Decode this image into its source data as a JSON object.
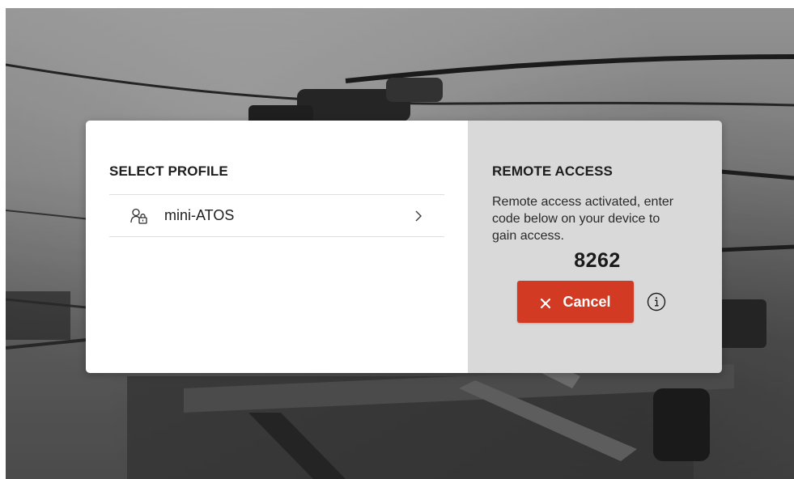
{
  "profiles_panel": {
    "title": "SELECT PROFILE",
    "items": [
      {
        "label": "mini-ATOS",
        "icon": "user-lock-icon",
        "trailing_icon": "chevron-right-icon"
      }
    ]
  },
  "remote_panel": {
    "title": "REMOTE ACCESS",
    "message": "Remote access activated, enter code below on your device to gain access.",
    "code": "8262",
    "cancel_label": "Cancel",
    "cancel_icon": "close-icon",
    "info_icon": "info-icon"
  },
  "colors": {
    "cancel_button": "#d23a24",
    "remote_panel_bg": "#d9d9d9",
    "profile_panel_bg": "#ffffff",
    "text": "#1e1e1e"
  }
}
